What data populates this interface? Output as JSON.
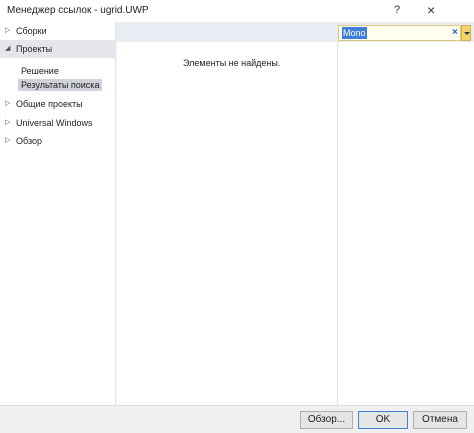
{
  "window": {
    "title": "Менеджер ссылок - ugrid.UWP",
    "help_glyph": "?",
    "close_glyph": "×"
  },
  "sidebar": {
    "items": [
      {
        "label": "Сборки",
        "icon": "expand-triangle-icon",
        "expanded": false
      },
      {
        "label": "Проекты",
        "icon": "collapse-triangle-icon",
        "expanded": true
      },
      {
        "label": "Общие проекты",
        "icon": "expand-triangle-icon",
        "expanded": false
      },
      {
        "label": "Universal Windows",
        "icon": "expand-triangle-icon",
        "expanded": false
      },
      {
        "label": "Обзор",
        "icon": "expand-triangle-icon",
        "expanded": false
      }
    ],
    "sub_items": [
      "Решение",
      "Результаты поиска"
    ]
  },
  "search": {
    "value": "Mono",
    "clear_glyph": "×"
  },
  "content": {
    "empty_message": "Элементы не найдены."
  },
  "buttons": {
    "browse": "Обзор...",
    "ok": "OK",
    "cancel": "Отмена"
  }
}
